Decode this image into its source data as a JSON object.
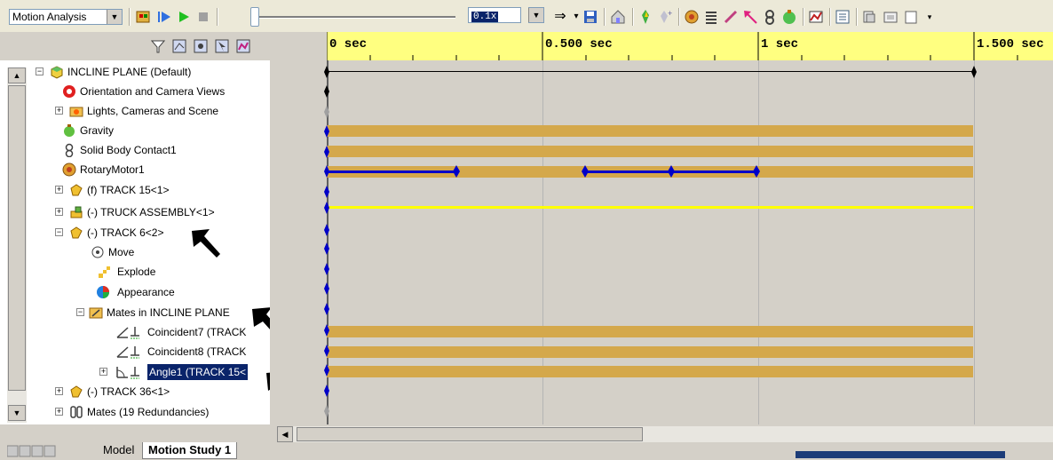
{
  "toolbar": {
    "study_type": "Motion Analysis",
    "playback_speed": "0.1x",
    "slider_position": 0.0
  },
  "timeline": {
    "tick_labels": [
      "0 sec",
      "0.500 sec",
      "1 sec",
      "1.500 sec"
    ]
  },
  "tree": {
    "items": [
      {
        "label": "INCLINE PLANE  (Default)",
        "icon": "assembly-icon"
      },
      {
        "label": "Orientation and Camera Views",
        "icon": "camera-views-icon"
      },
      {
        "label": "Lights, Cameras and Scene",
        "icon": "lights-folder-icon"
      },
      {
        "label": "Gravity",
        "icon": "gravity-icon"
      },
      {
        "label": "Solid Body Contact1",
        "icon": "contact-icon"
      },
      {
        "label": "RotaryMotor1",
        "icon": "motor-icon"
      },
      {
        "label": "(f) TRACK 15<1>",
        "icon": "part-icon"
      },
      {
        "label": "(-) TRUCK ASSEMBLY<1>",
        "icon": "subassembly-icon"
      },
      {
        "label": "(-) TRACK 6<2>",
        "icon": "part-icon"
      },
      {
        "label": "Move",
        "icon": "move-icon"
      },
      {
        "label": "Explode",
        "icon": "explode-icon"
      },
      {
        "label": "Appearance",
        "icon": "appearance-icon"
      },
      {
        "label": "Mates in INCLINE PLANE",
        "icon": "mates-folder-icon"
      },
      {
        "label": "Coincident7 (TRACK",
        "icon": "coincident-mate-icon"
      },
      {
        "label": "Coincident8 (TRACK",
        "icon": "coincident-mate-icon"
      },
      {
        "label": "Angle1 (TRACK 15<",
        "icon": "angle-mate-icon"
      },
      {
        "label": "(-) TRACK 36<1>",
        "icon": "part-icon"
      },
      {
        "label": "Mates (19 Redundancies)",
        "icon": "mates-icon"
      }
    ]
  },
  "tabs": {
    "model": "Model",
    "motion_study": "Motion Study 1"
  },
  "colors": {
    "timeline_bar": "#d4a84b",
    "key_blue": "#0000c8",
    "header_yellow": "#ffff80",
    "selection": "#0a246a"
  }
}
